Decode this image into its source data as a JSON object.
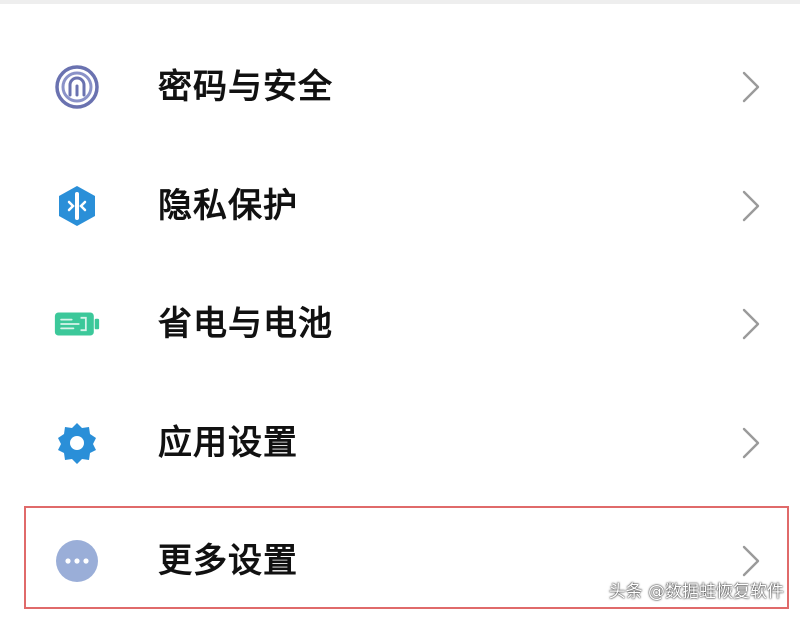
{
  "settings": {
    "items": [
      {
        "label": "密码与安全",
        "icon": "fingerprint-icon",
        "icon_color": "#6a72b0"
      },
      {
        "label": "隐私保护",
        "icon": "shield-icon",
        "icon_color": "#2a8fd8"
      },
      {
        "label": "省电与电池",
        "icon": "battery-icon",
        "icon_color": "#3cc89a"
      },
      {
        "label": "应用设置",
        "icon": "gear-icon",
        "icon_color": "#2a8fd8"
      },
      {
        "label": "更多设置",
        "icon": "more-dots-icon",
        "icon_color": "#9aaed8"
      }
    ],
    "highlight_color": "#e06a6a"
  },
  "watermark": {
    "text": "头条 @数据蛙恢复软件"
  }
}
